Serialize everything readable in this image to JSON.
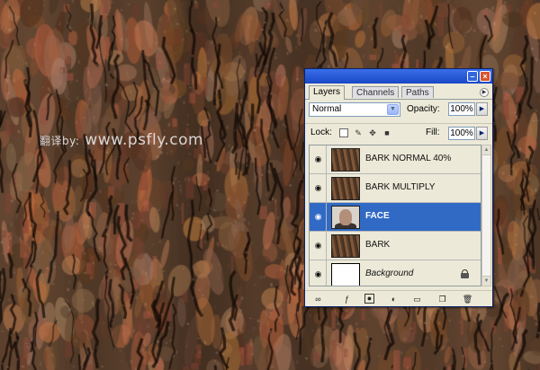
{
  "watermark": {
    "prefix": "翻译by:",
    "url": "www.psfly.com"
  },
  "panel": {
    "tabs": [
      {
        "label": "Layers",
        "active": true
      },
      {
        "label": "Channels",
        "active": false
      },
      {
        "label": "Paths",
        "active": false
      }
    ],
    "blend_mode": "Normal",
    "opacity_label": "Opacity:",
    "opacity_value": "100%",
    "lock_label": "Lock:",
    "fill_label": "Fill:",
    "fill_value": "100%",
    "layers": [
      {
        "name": "BARK NORMAL 40%",
        "thumbnail": "bark-texture",
        "selected": false
      },
      {
        "name": "BARK MULTIPLY",
        "thumbnail": "bark-texture",
        "selected": false
      },
      {
        "name": "FACE",
        "thumbnail": "face-portrait",
        "selected": true
      },
      {
        "name": "BARK",
        "thumbnail": "bark-texture",
        "selected": false
      },
      {
        "name": "Background",
        "thumbnail": "white",
        "selected": false,
        "locked": true
      }
    ],
    "bottom_icons": [
      "link-icon",
      "layer-style-icon",
      "mask-icon",
      "adjustment-icon",
      "folder-icon",
      "new-layer-icon",
      "trash-icon"
    ]
  },
  "colors": {
    "titlebar": "#1947c7",
    "panel_bg": "#ece9d8",
    "selection": "#316ac5",
    "close_button": "#d9542e"
  }
}
